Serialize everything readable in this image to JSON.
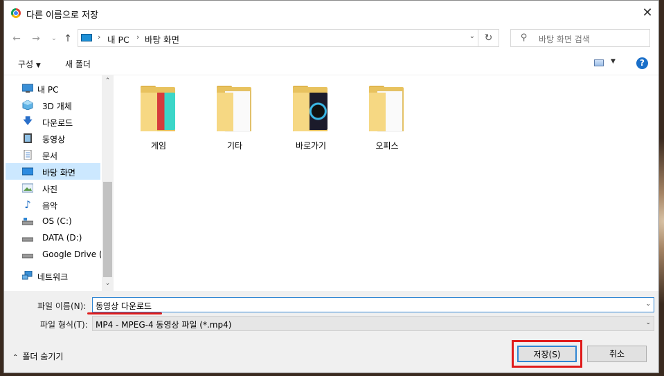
{
  "window": {
    "title": "다른 이름으로 저장"
  },
  "nav": {
    "back": "←",
    "forward": "→",
    "recent": "⌄",
    "up": "↑",
    "breadcrumb": [
      "내 PC",
      "바탕 화면"
    ],
    "refresh": "↻",
    "search_placeholder": "바탕 화면 검색"
  },
  "toolbar": {
    "organize": "구성",
    "new_folder": "새 폴더",
    "help": "?"
  },
  "sidebar": {
    "items": [
      {
        "label": "내 PC",
        "icon": "pc-icon"
      },
      {
        "label": "3D 개체",
        "icon": "cube-icon"
      },
      {
        "label": "다운로드",
        "icon": "download-icon"
      },
      {
        "label": "동영상",
        "icon": "video-icon"
      },
      {
        "label": "문서",
        "icon": "document-icon"
      },
      {
        "label": "바탕 화면",
        "icon": "desktop-icon",
        "selected": true
      },
      {
        "label": "사진",
        "icon": "picture-icon"
      },
      {
        "label": "음악",
        "icon": "music-icon"
      },
      {
        "label": "OS (C:)",
        "icon": "drive-icon"
      },
      {
        "label": "DATA (D:)",
        "icon": "drive-icon"
      },
      {
        "label": "Google Drive (G",
        "icon": "drive-icon"
      },
      {
        "label": "네트워크",
        "icon": "network-icon"
      }
    ]
  },
  "folders": [
    {
      "label": "게임"
    },
    {
      "label": "기타"
    },
    {
      "label": "바로가기"
    },
    {
      "label": "오피스"
    }
  ],
  "form": {
    "filename_label": "파일 이름(N):",
    "filename_value": "동영상 다운로드",
    "filetype_label": "파일 형식(T):",
    "filetype_value": "MP4 - MPEG-4 동영상 파일 (*.mp4)"
  },
  "footer": {
    "hide_folders": "폴더 숨기기",
    "save": "저장(S)",
    "cancel": "취소"
  },
  "colors": {
    "accent": "#2f86d3",
    "highlight": "#e01b1b",
    "selection": "#cce8ff"
  }
}
